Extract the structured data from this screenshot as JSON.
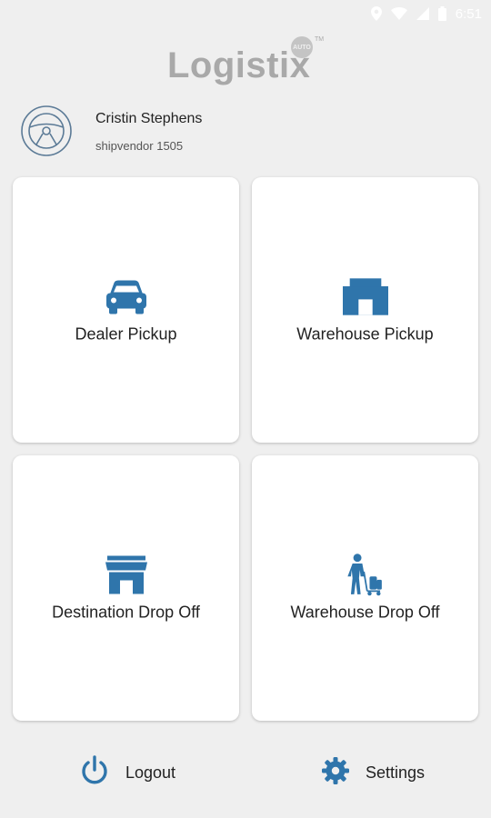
{
  "status_bar": {
    "time": "6:51"
  },
  "brand": {
    "name": "Logistix",
    "badge": "AUTO",
    "tm": "TM"
  },
  "profile": {
    "name": "Cristin Stephens",
    "subtitle": "shipvendor 1505"
  },
  "tiles": [
    {
      "label": "Dealer Pickup",
      "icon": "car-icon"
    },
    {
      "label": "Warehouse Pickup",
      "icon": "warehouse-icon"
    },
    {
      "label": "Destination Drop Off",
      "icon": "storefront-icon"
    },
    {
      "label": "Warehouse Drop Off",
      "icon": "person-luggage-cart-icon"
    }
  ],
  "footer": {
    "logout_label": "Logout",
    "settings_label": "Settings"
  },
  "colors": {
    "accent": "#2f75ab",
    "logo_gray": "#a9a9a9",
    "background": "#efefef"
  }
}
